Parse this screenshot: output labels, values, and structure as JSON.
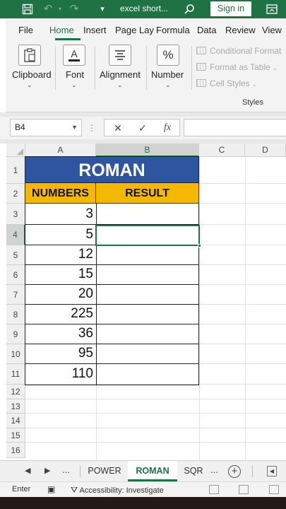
{
  "titlebar": {
    "title": "excel short...",
    "sign_in_label": "Sign in",
    "icons": [
      "save-icon",
      "undo-icon",
      "redo-icon",
      "quick-access-menu-icon",
      "search-icon",
      "ribbon-display-icon"
    ]
  },
  "ribbon_tabs": [
    "File",
    "Home",
    "Insert",
    "Page Lay",
    "Formula",
    "Data",
    "Review",
    "View"
  ],
  "active_tab": "Home",
  "ribbon": {
    "clipboard": "Clipboard",
    "font": "Font",
    "alignment": "Alignment",
    "number": "Number",
    "conditional_formatting": "Conditional Format",
    "format_as_table": "Format as Table",
    "cell_styles": "Cell Styles",
    "styles_group": "Styles"
  },
  "formula_bar": {
    "name_box": "B4",
    "formula_value": ""
  },
  "columns": [
    "A",
    "B",
    "C",
    "D"
  ],
  "rows": [
    "1",
    "2",
    "3",
    "4",
    "5",
    "6",
    "7",
    "8",
    "9",
    "10",
    "11",
    "12",
    "13",
    "14",
    "15",
    "16"
  ],
  "selected_column": "B",
  "selected_row": "4",
  "table": {
    "title": "ROMAN",
    "header_numbers": "NUMBERS",
    "header_result": "RESULT",
    "numbers": [
      "3",
      "5",
      "12",
      "15",
      "20",
      "225",
      "36",
      "95",
      "110"
    ],
    "results": [
      "",
      "",
      "",
      "",
      "",
      "",
      "",
      "",
      ""
    ]
  },
  "sheets": {
    "ellipsis": "...",
    "tabs": [
      "POWER",
      "ROMAN",
      "SQR"
    ],
    "active": "ROMAN"
  },
  "status": {
    "mode": "Enter",
    "accessibility": "Accessibility: Investigate"
  },
  "colors": {
    "excel_green": "#1f7244",
    "title_fill": "#2e55a0",
    "header_fill": "#f5b800"
  }
}
